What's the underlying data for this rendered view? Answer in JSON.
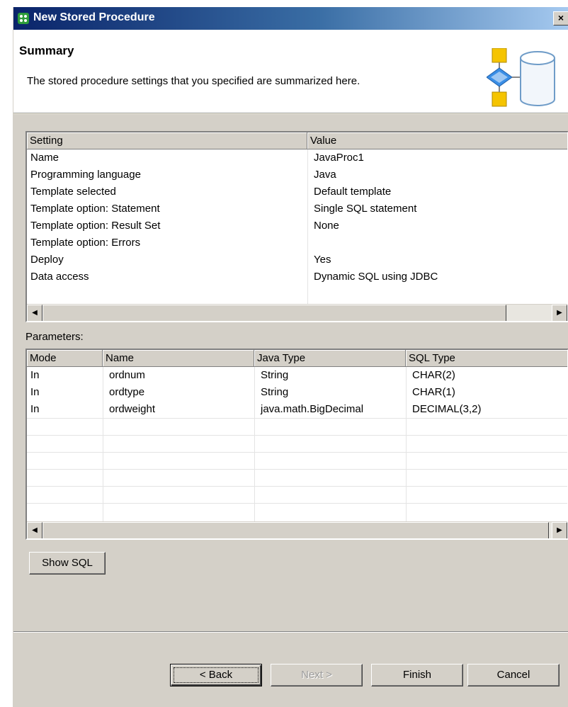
{
  "window": {
    "title": "New Stored Procedure",
    "close_label": "×"
  },
  "banner": {
    "title": "Summary",
    "description": "The stored procedure settings that you specified are summarized here."
  },
  "summary_table": {
    "headers": [
      "Setting",
      "Value"
    ],
    "rows": [
      [
        "Name",
        "JavaProc1"
      ],
      [
        "Programming language",
        "Java"
      ],
      [
        "Template selected",
        "Default template"
      ],
      [
        "Template option: Statement",
        "Single SQL statement"
      ],
      [
        "Template option: Result Set",
        "None"
      ],
      [
        "Template option: Errors",
        ""
      ],
      [
        "Deploy",
        "Yes"
      ],
      [
        "Data access",
        "Dynamic SQL using JDBC"
      ]
    ]
  },
  "parameters": {
    "label": "Parameters:",
    "headers": [
      "Mode",
      "Name",
      "Java Type",
      "SQL Type"
    ],
    "rows": [
      [
        "In",
        "ordnum",
        "String",
        "CHAR(2)"
      ],
      [
        "In",
        "ordtype",
        "String",
        "CHAR(1)"
      ],
      [
        "In",
        "ordweight",
        "java.math.BigDecimal",
        "DECIMAL(3,2)"
      ]
    ]
  },
  "buttons": {
    "show_sql": "Show SQL",
    "back": "< Back",
    "next": "Next >",
    "finish": "Finish",
    "cancel": "Cancel"
  },
  "icons": {
    "title": "wizard-app-icon",
    "banner": "stored-procedure-database-icon",
    "scroll_left": "arrow-left-icon",
    "scroll_right": "arrow-right-icon"
  },
  "colors": {
    "titlebar_start": "#0a246a",
    "titlebar_end": "#a6caf0",
    "icon_yellow": "#f5c400",
    "icon_blue": "#3a8ee6"
  }
}
